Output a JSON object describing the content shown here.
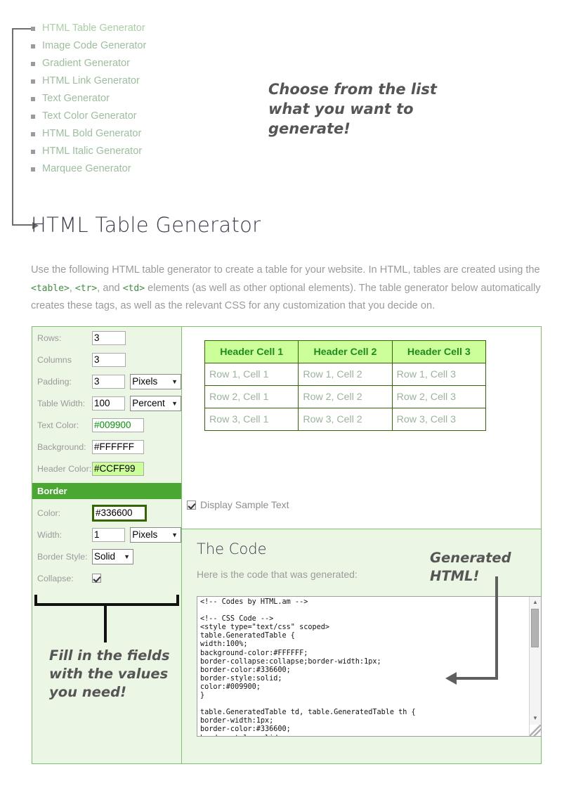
{
  "generator_list": {
    "items": [
      {
        "label": "HTML Table Generator",
        "current": true
      },
      {
        "label": "Image Code Generator",
        "current": false
      },
      {
        "label": "Gradient Generator",
        "current": false
      },
      {
        "label": "HTML Link Generator",
        "current": false
      },
      {
        "label": "Text Generator",
        "current": false
      },
      {
        "label": "Text Color Generator",
        "current": false
      },
      {
        "label": "HTML Bold Generator",
        "current": false
      },
      {
        "label": "HTML Italic Generator",
        "current": false
      },
      {
        "label": "Marquee Generator",
        "current": false
      }
    ]
  },
  "annotations": {
    "choose": "Choose from the list what you want to generate!",
    "fill": "Fill in the fields with the values you need!",
    "generated": "Generated HTML!"
  },
  "page": {
    "title": "HTML Table Generator",
    "intro_part1": "Use the following HTML table generator to create a table for your website. In HTML, tables are created using the ",
    "intro_code1": "<table>",
    "intro_sep1": ", ",
    "intro_code2": "<tr>",
    "intro_sep2": ", and ",
    "intro_code3": "<td>",
    "intro_part2": " elements (as well as other optional elements). The table generator below automatically creates these tags, as well as the relevant CSS for any customization that you decide on."
  },
  "form": {
    "rows_label": "Rows:",
    "rows_value": "3",
    "columns_label": "Columns",
    "columns_value": "3",
    "padding_label": "Padding:",
    "padding_value": "3",
    "padding_unit": "Pixels",
    "table_width_label": "Table Width:",
    "table_width_value": "100",
    "table_width_unit": "Percent",
    "text_color_label": "Text Color:",
    "text_color_value": "#009900",
    "background_label": "Background:",
    "background_value": "#FFFFFF",
    "header_color_label": "Header Color:",
    "header_color_value": "#CCFF99",
    "border_section_title": "Border",
    "border_color_label": "Color:",
    "border_color_value": "#336600",
    "border_width_label": "Width:",
    "border_width_value": "1",
    "border_width_unit": "Pixels",
    "border_style_label": "Border Style:",
    "border_style_value": "Solid",
    "collapse_label": "Collapse:"
  },
  "preview": {
    "headers": [
      "Header Cell 1",
      "Header Cell 2",
      "Header Cell 3"
    ],
    "rows": [
      [
        "Row 1, Cell 1",
        "Row 1, Cell 2",
        "Row 1, Cell 3"
      ],
      [
        "Row 2, Cell 1",
        "Row 2, Cell 2",
        "Row 2, Cell 3"
      ],
      [
        "Row 3, Cell 1",
        "Row 3, Cell 2",
        "Row 3, Cell 3"
      ]
    ],
    "display_sample_text_label": "Display Sample Text"
  },
  "code": {
    "title": "The Code",
    "subtitle": "Here is the code that was generated:",
    "content": "<!-- Codes by HTML.am -->\n\n<!-- CSS Code -->\n<style type=\"text/css\" scoped>\ntable.GeneratedTable {\nwidth:100%;\nbackground-color:#FFFFFF;\nborder-collapse:collapse;border-width:1px;\nborder-color:#336600;\nborder-style:solid;\ncolor:#009900;\n}\n\ntable.GeneratedTable td, table.GeneratedTable th {\nborder-width:1px;\nborder-color:#336600;\nborder-style:solid;"
  },
  "colors": {
    "accent_green": "#4aa832",
    "border_green": "#7dc36b",
    "panel_bg": "#ecf6e5",
    "header_cell_bg": "#ccff99",
    "header_cell_text": "#1d8b1d",
    "dark_green": "#336600"
  },
  "icons": {
    "caret": "▼",
    "scroll_up": "▲",
    "scroll_down": "▼"
  }
}
